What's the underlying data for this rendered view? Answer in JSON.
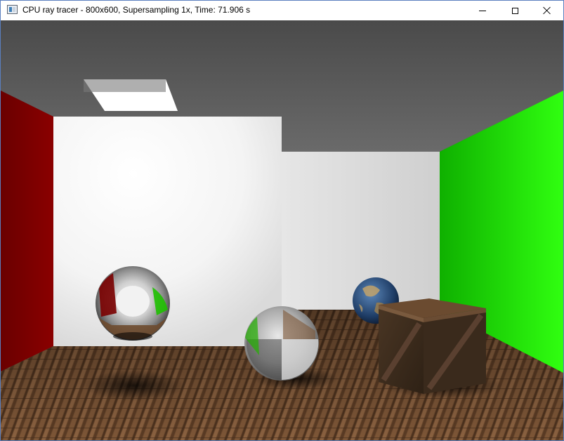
{
  "window": {
    "title": "CPU ray tracer - 800x600, Supersampling 1x, Time: 71.906 s",
    "app_icon": "window-icon",
    "controls": {
      "minimize_icon": "minimize-icon",
      "maximize_icon": "maximize-icon",
      "close_icon": "close-icon"
    }
  },
  "scene": {
    "description_icon": "rendered-image",
    "colors": {
      "left_wall": "#7a0000",
      "right_wall": "#22e000",
      "back_wall": "#ffffff",
      "ceiling": "#5a5a5a",
      "floor": "#6b4a2e"
    }
  }
}
